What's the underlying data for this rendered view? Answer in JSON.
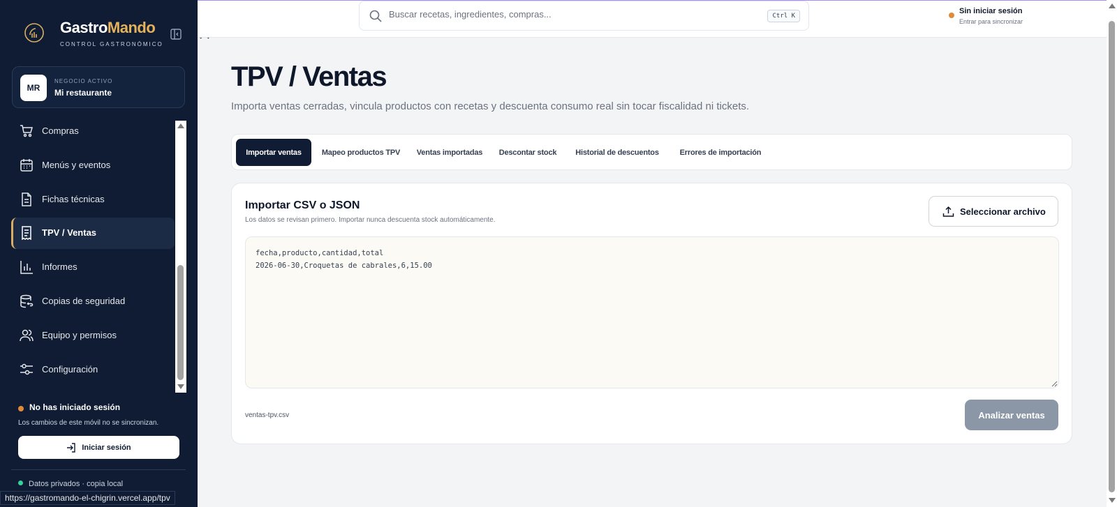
{
  "brand": {
    "name_part1": "Gastro",
    "name_part2": "Mando",
    "subtitle": "CONTROL GASTRONÓMICO",
    "accent": "#e3b25b"
  },
  "business": {
    "initials": "MR",
    "label": "NEGOCIO ACTIVO",
    "name": "Mi restaurante"
  },
  "sidebar": {
    "items": [
      {
        "label": "Compras",
        "icon": "cart-icon",
        "active": false
      },
      {
        "label": "Menús y eventos",
        "icon": "calendar-icon",
        "active": false
      },
      {
        "label": "Fichas técnicas",
        "icon": "document-icon",
        "active": false
      },
      {
        "label": "TPV / Ventas",
        "icon": "receipt-icon",
        "active": true
      },
      {
        "label": "Informes",
        "icon": "bar-chart-icon",
        "active": false
      },
      {
        "label": "Copias de seguridad",
        "icon": "database-backup-icon",
        "active": false
      },
      {
        "label": "Equipo y permisos",
        "icon": "users-icon",
        "active": false
      },
      {
        "label": "Configuración",
        "icon": "sliders-icon",
        "active": false
      }
    ]
  },
  "session": {
    "title": "No has iniciado sesión",
    "note": "Los cambios de este móvil no se sincronizan.",
    "login_label": "Iniciar sesión",
    "privacy": "Datos privados · copia local"
  },
  "status_url": "https://gastromando-el-chigrin.vercel.app/tpv",
  "topbar": {
    "search_placeholder": "Buscar recetas, ingredientes, compras...",
    "shortcut": "Ctrl K",
    "status_title": "Sin iniciar sesión",
    "status_sub": "Entrar para sincronizar"
  },
  "page": {
    "title": "TPV / Ventas",
    "subtitle": "Importa ventas cerradas, vincula productos con recetas y descuenta consumo real sin tocar fiscalidad ni tickets."
  },
  "tabs": [
    {
      "label": "Importar ventas",
      "active": true
    },
    {
      "label": "Mapeo productos TPV",
      "active": false
    },
    {
      "label": "Ventas importadas",
      "active": false
    },
    {
      "label": "Descontar stock",
      "active": false
    },
    {
      "label": "Historial de descuentos",
      "active": false
    },
    {
      "label": "Errores de importación",
      "active": false
    }
  ],
  "import_card": {
    "title": "Importar CSV o JSON",
    "subtitle": "Los datos se revisan primero. Importar nunca descuenta stock automáticamente.",
    "file_button": "Seleccionar archivo",
    "data": "fecha,producto,cantidad,total\n2026-06-30,Croquetas de cabrales,6,15.00",
    "file_name": "ventas-tpv.csv",
    "analyze_button": "Analizar ventas"
  }
}
